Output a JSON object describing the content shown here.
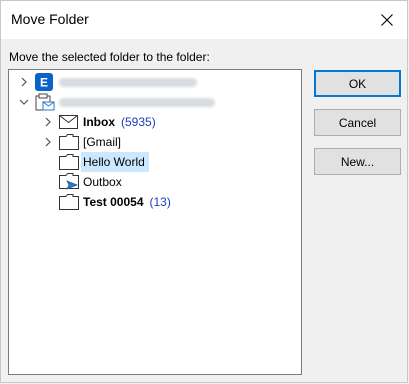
{
  "window": {
    "title": "Move Folder"
  },
  "prompt": "Move the selected folder to the folder:",
  "tree": {
    "items": [
      {
        "label": "Inbox",
        "count": "(5935)"
      },
      {
        "label": "[Gmail]"
      },
      {
        "label": "Hello World"
      },
      {
        "label": "Outbox"
      },
      {
        "label": "Test 00054",
        "count": "(13)"
      }
    ]
  },
  "buttons": {
    "ok": "OK",
    "cancel": "Cancel",
    "new": "New..."
  },
  "colors": {
    "selection": "#cce8ff",
    "accent": "#0078d7",
    "count": "#1e3cbe"
  }
}
